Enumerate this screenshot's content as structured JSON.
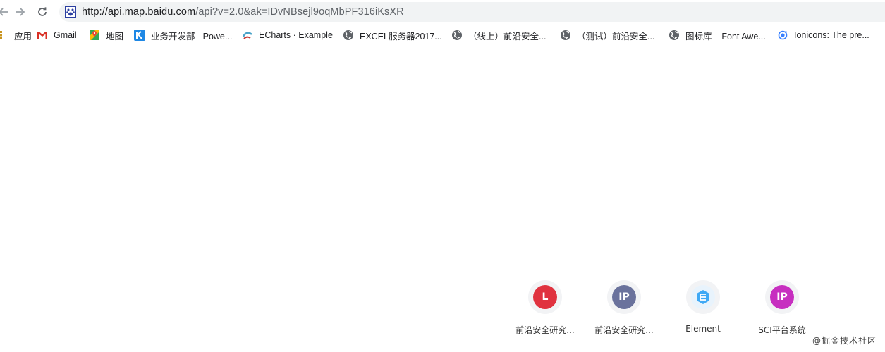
{
  "address_bar": {
    "url_host": "http://api.map.baidu.com",
    "url_path": "/api?v=2.0&ak=IDvNBsejl9oqMbPF316iKsXR"
  },
  "bookmarks": [
    {
      "label": "应用",
      "icon": "apps-grid-icon"
    },
    {
      "label": "Gmail",
      "icon": "gmail-icon"
    },
    {
      "label": "地图",
      "icon": "maps-icon"
    },
    {
      "label": "业务开发部 - Powe...",
      "icon": "k-logo-icon"
    },
    {
      "label": "ECharts · Example",
      "icon": "echarts-icon"
    },
    {
      "label": "EXCEL服务器2017...",
      "icon": "globe-icon"
    },
    {
      "label": "（线上）前沿安全...",
      "icon": "globe-icon"
    },
    {
      "label": "（测试）前沿安全...",
      "icon": "globe-icon"
    },
    {
      "label": "图标库 – Font Awe...",
      "icon": "globe-icon"
    },
    {
      "label": "Ionicons: The pre...",
      "icon": "ionicons-icon"
    }
  ],
  "apps": [
    {
      "letter": "L",
      "label": "前沿安全研究...",
      "color": "#e0323f"
    },
    {
      "letter": "IP",
      "label": "前沿安全研究...",
      "color": "#6a729c"
    },
    {
      "letter": "",
      "label": "Element",
      "color": "#3fa9f5"
    },
    {
      "letter": "IP",
      "label": "SCI平台系统",
      "color": "#c72fc0"
    }
  ],
  "watermark": "@掘金技术社区"
}
